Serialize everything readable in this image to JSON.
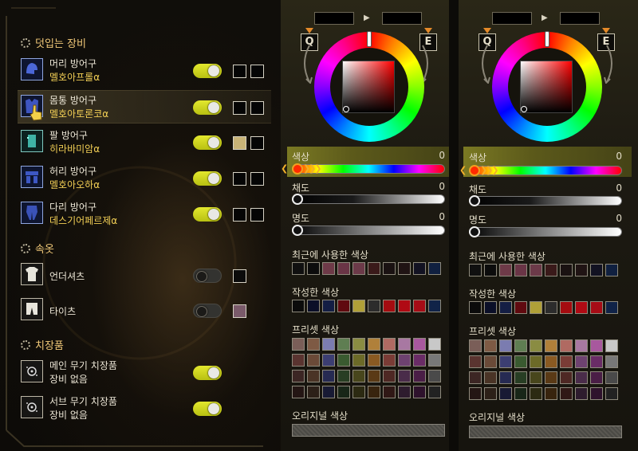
{
  "layer_section": {
    "title": "덧입는 장비"
  },
  "armor": [
    {
      "slot": "머리 방어구",
      "name": "멜호아프롤α",
      "toggle": "on",
      "swatch1": "#050505",
      "swatch2": "#050505",
      "icon": "helmet-icon"
    },
    {
      "slot": "몸통 방어구",
      "name": "멜호아토론코α",
      "toggle": "on",
      "swatch1": "#050505",
      "swatch2": "#050505",
      "icon": "chest-armor-icon"
    },
    {
      "slot": "팔 방어구",
      "name": "히라바미암α",
      "toggle": "on",
      "swatch1": "#c8b377",
      "swatch2": "#050505",
      "icon": "gauntlet-icon"
    },
    {
      "slot": "허리 방어구",
      "name": "멜호아오하α",
      "toggle": "on",
      "swatch1": "#050505",
      "swatch2": "#050505",
      "icon": "waist-armor-icon"
    },
    {
      "slot": "다리 방어구",
      "name": "데스기어페르제α",
      "toggle": "on",
      "swatch1": "#050505",
      "swatch2": "#050505",
      "icon": "leg-armor-icon"
    }
  ],
  "inner_section": {
    "title": "속옷"
  },
  "inner": [
    {
      "name": "언더셔츠",
      "toggle": "off",
      "swatch": "#0b0b0b",
      "icon": "undershirt-icon"
    },
    {
      "name": "타이츠",
      "toggle": "off",
      "swatch": "#7a5a6a",
      "icon": "tights-icon"
    }
  ],
  "deco_section": {
    "title": "치장품"
  },
  "deco": [
    {
      "slot": "메인 무기 치장품",
      "name": "장비 없음",
      "toggle": "on",
      "icon": "weapon-charm-icon"
    },
    {
      "slot": "서브 무기 치장품",
      "name": "장비 없음",
      "toggle": "on",
      "icon": "weapon-charm-icon"
    }
  ],
  "panels": [
    {
      "arrow": "▶",
      "q": "Q",
      "e": "E",
      "hue_label": "색상",
      "hue_value": "0",
      "sat_label": "채도",
      "sat_value": "0",
      "val_label": "명도",
      "val_value": "0",
      "recent_label": "최근에 사용한 색상",
      "created_label": "작성한 색상",
      "preset_label": "프리셋 색상",
      "original_label": "오리지널 색상"
    },
    {
      "arrow": "▶",
      "q": "Q",
      "e": "E",
      "hue_label": "색상",
      "hue_value": "0",
      "sat_label": "채도",
      "sat_value": "0",
      "val_label": "명도",
      "val_value": "0",
      "recent_label": "최근에 사용한 색상",
      "created_label": "작성한 색상",
      "preset_label": "프리셋 색상",
      "original_label": "오리지널 색상"
    }
  ],
  "recent_colors": [
    "#101010",
    "#0c0c0c",
    "#6e3a48",
    "#6a3546",
    "#6c3a49",
    "#3a1a1a",
    "#1a1212",
    "#201414",
    "#121222",
    "#102040"
  ],
  "created_colors": [
    "#0b0b0b",
    "#0b0f28",
    "#141e44",
    "#600a10",
    "#b0a038",
    "#2c2c2c",
    "#a40c10",
    "#b00a14",
    "#a60c16",
    "#102348"
  ],
  "preset_colors": [
    [
      "#7a5e58",
      "#7e5a44",
      "#7b7cb0",
      "#5f7e52",
      "#8a8c42",
      "#b0803a",
      "#b06a62",
      "#a878a2",
      "#a8589e",
      "#c8c8c8"
    ],
    [
      "#5a3430",
      "#6a4a38",
      "#3c3e72",
      "#3a5a30",
      "#6c6a28",
      "#8a5a22",
      "#7a3c36",
      "#6e4270",
      "#6a2c66",
      "#787878"
    ],
    [
      "#3c2624",
      "#4a3426",
      "#262a52",
      "#283e24",
      "#48461c",
      "#5a3a16",
      "#4e2824",
      "#4a2c4a",
      "#4a1e46",
      "#4a4a4a"
    ],
    [
      "#241614",
      "#2c2018",
      "#181a34",
      "#182618",
      "#2c2a12",
      "#38240e",
      "#301816",
      "#2e1c2e",
      "#2e122c",
      "#222222"
    ]
  ]
}
